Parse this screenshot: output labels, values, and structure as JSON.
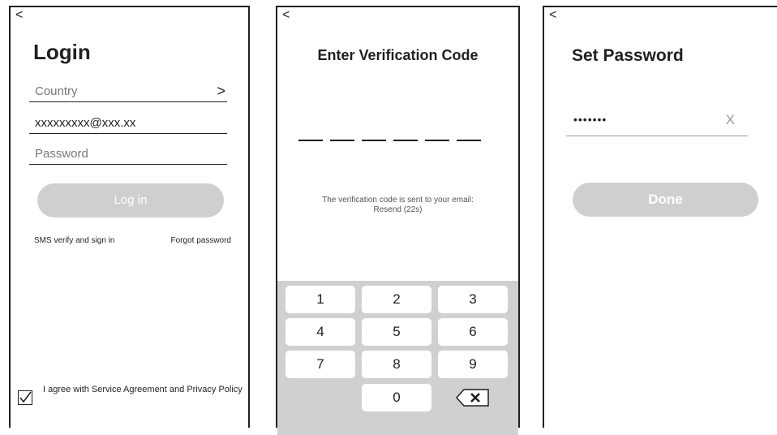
{
  "login": {
    "back": "<",
    "title": "Login",
    "country_label": "Country",
    "country_chevron": ">",
    "email_value": "xxxxxxxxx@xxx.xx",
    "password_placeholder": "Password",
    "login_button": "Log in",
    "sms_link": "SMS verify and sign in",
    "forgot_link": "Forgot password",
    "agreement_text": "I agree with Service Agreement and Privacy Policy",
    "agreement_checked": true
  },
  "verify": {
    "back": "<",
    "title": "Enter Verification Code",
    "code_slots": 6,
    "message_line1": "The verification code is sent to your email:",
    "message_line2": "Resend (22s)",
    "keys": [
      "1",
      "2",
      "3",
      "4",
      "5",
      "6",
      "7",
      "8",
      "9",
      "",
      "0",
      "backspace-icon"
    ]
  },
  "password": {
    "back": "<",
    "title": "Set Password",
    "masked_value": "•••••••",
    "clear_icon": "X",
    "done_button": "Done"
  },
  "colors": {
    "border": "#231f20",
    "button_gray": "#cfcfcf",
    "keypad_bg": "#d0d0d0"
  }
}
